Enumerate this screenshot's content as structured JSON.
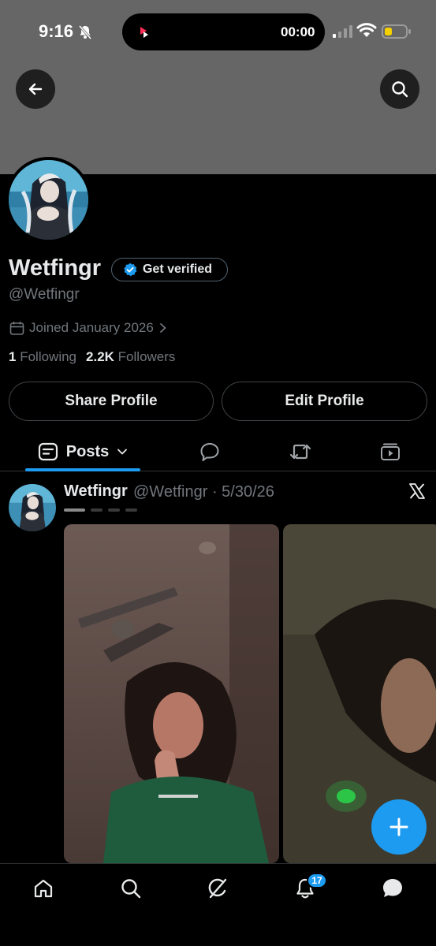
{
  "status_bar": {
    "time": "9:16",
    "island_timer": "00:00",
    "battery_color": "#f5d000"
  },
  "header": {
    "back_icon": "arrow-left-icon",
    "search_icon": "search-icon",
    "banner_color": "#666666"
  },
  "profile": {
    "display_name": "Wetfingr",
    "verify_label": "Get verified",
    "handle": "@Wetfingr",
    "joined": "Joined January 2026",
    "following_count": "1",
    "following_label": "Following",
    "followers_count": "2.2K",
    "followers_label": "Followers"
  },
  "actions": {
    "share": "Share Profile",
    "edit": "Edit Profile"
  },
  "tabs": {
    "active": "Posts",
    "icons": [
      "posts-icon",
      "replies-icon",
      "repost-icon",
      "media-icon"
    ]
  },
  "post": {
    "author": "Wetfingr",
    "meta": "@Wetfingr · 5/30/26",
    "media_count": 4,
    "active_media_index": 1
  },
  "bottom_nav": {
    "notification_count": "17",
    "icons": [
      "home-icon",
      "search-icon",
      "grok-icon",
      "bell-icon",
      "messages-icon"
    ]
  },
  "colors": {
    "accent": "#1d9bf0",
    "secondary_text": "#71767b",
    "background": "#000000"
  }
}
